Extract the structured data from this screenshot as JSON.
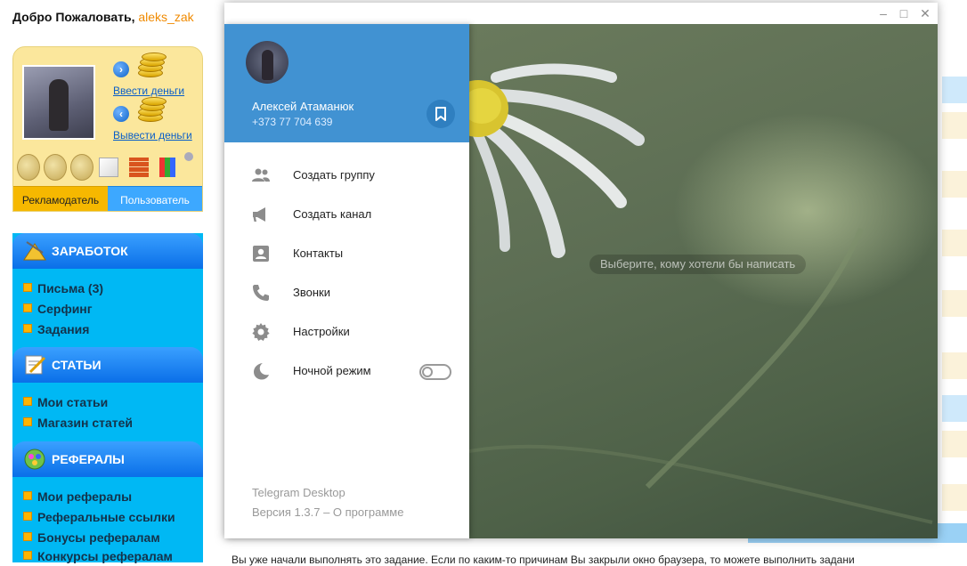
{
  "site": {
    "welcome_text": "Добро Пожаловать,",
    "username": "aleks_zak",
    "deposit_link": "Ввести деньги",
    "withdraw_link": "Вывести деньги",
    "tab_advertiser": "Рекламодатель",
    "tab_user": "Пользователь",
    "sections": [
      {
        "title": "ЗАРАБОТОК",
        "items": [
          "Письма (3)",
          "Серфинг",
          "Задания"
        ]
      },
      {
        "title": "СТАТЬИ",
        "items": [
          "Мои статьи",
          "Магазин статей"
        ]
      },
      {
        "title": "РЕФЕРАЛЫ",
        "items": [
          "Мои рефералы",
          "Реферальные ссылки",
          "Бонусы рефералам",
          "Конкурсы рефералам"
        ]
      }
    ],
    "bottom_text": "Вы уже начали выполнять это задание. Если по каким-то причинам Вы закрыли окно браузера, то можете выполнить задани"
  },
  "telegram": {
    "profile": {
      "name": "Алексей Атаманюк",
      "phone": "+373 77 704 639"
    },
    "menu": [
      {
        "label": "Создать группу",
        "icon": "group-icon"
      },
      {
        "label": "Создать канал",
        "icon": "megaphone-icon"
      },
      {
        "label": "Контакты",
        "icon": "contacts-icon"
      },
      {
        "label": "Звонки",
        "icon": "phone-icon"
      },
      {
        "label": "Настройки",
        "icon": "gear-icon"
      },
      {
        "label": "Ночной режим",
        "icon": "moon-icon"
      }
    ],
    "night_mode_enabled": false,
    "app_name": "Telegram Desktop",
    "version_text": "Версия 1.3.7 – О программе",
    "empty_chat_hint": "Выберите, кому хотели бы написать",
    "colors": {
      "header_blue": "#4192d2",
      "accent_saved": "#2f7fc0"
    }
  }
}
